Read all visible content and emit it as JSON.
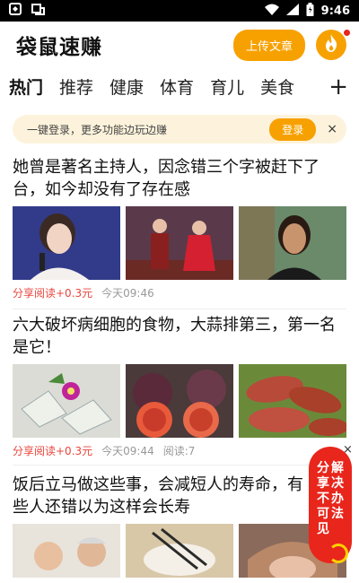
{
  "status_bar": {
    "time": "9:46"
  },
  "header": {
    "app_title": "袋鼠速赚",
    "upload_label": "上传文章"
  },
  "tabs": [
    {
      "label": "热门",
      "active": true
    },
    {
      "label": "推荐"
    },
    {
      "label": "健康"
    },
    {
      "label": "体育"
    },
    {
      "label": "育儿"
    },
    {
      "label": "美食"
    }
  ],
  "tab_more": "+",
  "login_banner": {
    "text": "一键登录，更多功能边玩边赚",
    "button": "登录",
    "close": "×"
  },
  "articles": [
    {
      "title": "她曾是著名主持人，因念错三个字被赶下了台，如今却没有了存在感",
      "share": "分享阅读+0.3元",
      "time": "今天09:46",
      "reads": ""
    },
    {
      "title": "六大破坏病细胞的食物，大蒜排第三，第一名是它！",
      "share": "分享阅读+0.3元",
      "time": "今天09:44",
      "reads": "阅读:7"
    },
    {
      "title": "饭后立马做这些事，会减短人的寿命，有些人还错以为这样会长寿",
      "share": "",
      "time": "",
      "reads": ""
    }
  ],
  "float_widget": {
    "col1": [
      "分",
      "享",
      "不",
      "可",
      "见"
    ],
    "col2": [
      "解",
      "决",
      "办",
      "法"
    ],
    "close": "×"
  }
}
